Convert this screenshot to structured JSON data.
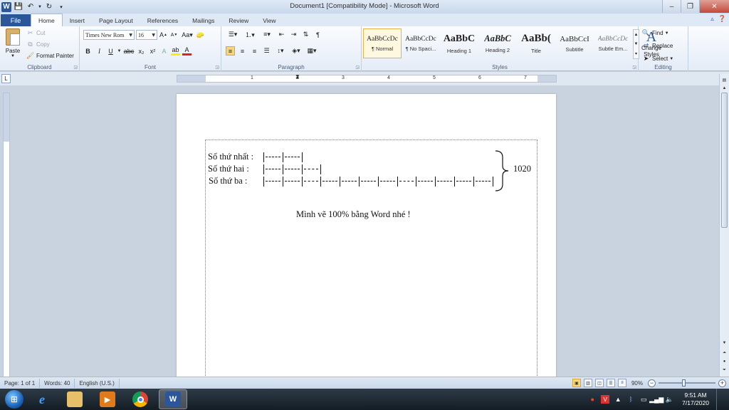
{
  "window": {
    "title": "Document1 [Compatibility Mode]  -  Microsoft Word",
    "logo": "W"
  },
  "tabs": [
    "File",
    "Home",
    "Insert",
    "Page Layout",
    "References",
    "Mailings",
    "Review",
    "View"
  ],
  "ribbon": {
    "clipboard": {
      "label": "Clipboard",
      "paste": "Paste",
      "cut": "Cut",
      "copy": "Copy",
      "format_painter": "Format Painter"
    },
    "font": {
      "label": "Font",
      "font_name": "Times New Rom",
      "font_size": "16"
    },
    "paragraph": {
      "label": "Paragraph"
    },
    "styles": {
      "label": "Styles",
      "items": [
        {
          "sample": "AaBbCcDc",
          "name": "¶ Normal"
        },
        {
          "sample": "AaBbCcDc",
          "name": "¶ No Spaci..."
        },
        {
          "sample": "AaBbC",
          "name": "Heading 1"
        },
        {
          "sample": "AaBbC",
          "name": "Heading 2"
        },
        {
          "sample": "AaBb(",
          "name": "Title"
        },
        {
          "sample": "AaBbCcI",
          "name": "Subtitle"
        },
        {
          "sample": "AaBbCcDc",
          "name": "Subtle Em..."
        }
      ],
      "change_styles": "Change Styles"
    },
    "editing": {
      "label": "Editing",
      "find": "Find",
      "replace": "Replace",
      "select": "Select"
    }
  },
  "ruler": {
    "labels": [
      "1",
      "2",
      "3",
      "4",
      "5",
      "6",
      "7"
    ]
  },
  "document": {
    "line1_label": "Số thứ nhất :",
    "line2_label": "Số thứ hai :",
    "line3_label": "Số thứ ba :",
    "line1_segments": 2,
    "line2_segments": 3,
    "line3_segments": 12,
    "total": "1020",
    "note": "Mình vẽ 100% bằng Word nhé !"
  },
  "status": {
    "page": "Page: 1 of 1",
    "words": "Words: 40",
    "language": "English (U.S.)",
    "zoom": "90%",
    "zoom_value": 90
  },
  "taskbar": {
    "time": "9:51 AM",
    "date": "7/17/2020"
  },
  "colors": {
    "file_tab": "#2b579a",
    "selected_style": "#e3b34d",
    "taskbar": "#1c2630"
  }
}
